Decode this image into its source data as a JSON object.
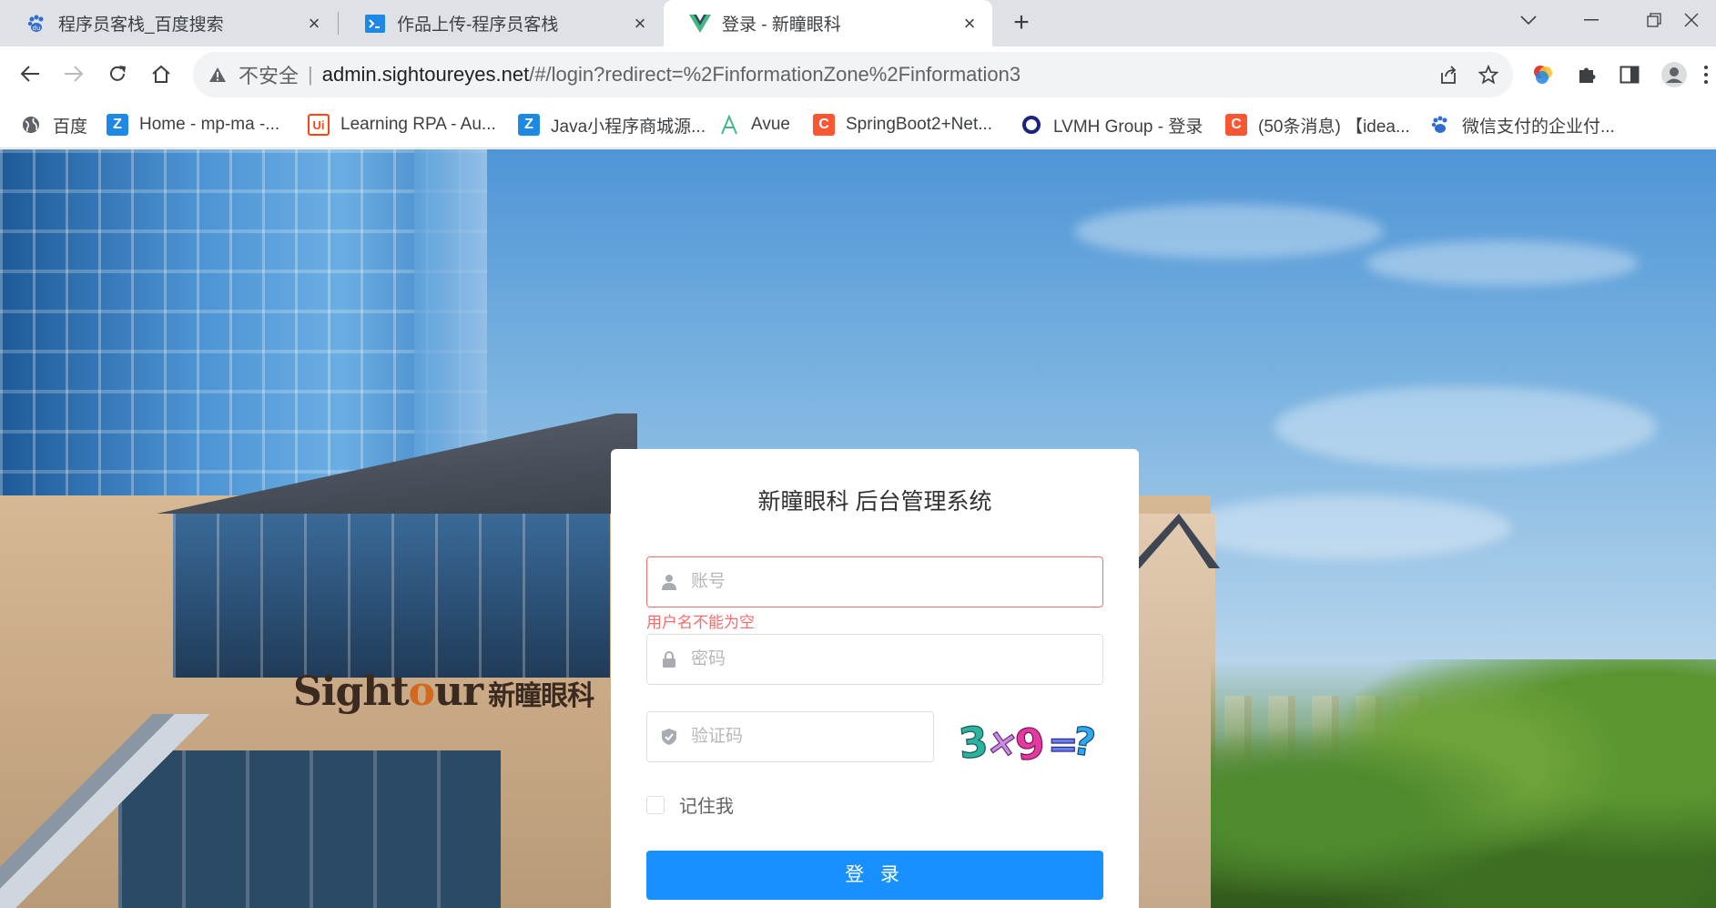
{
  "browser": {
    "tabs": [
      {
        "title": "程序员客栈_百度搜索",
        "active": false,
        "favicon": "baidu-paw-icon"
      },
      {
        "title": "作品上传-程序员客栈",
        "active": false,
        "favicon": "terminal-icon"
      },
      {
        "title": "登录 - 新瞳眼科",
        "active": true,
        "favicon": "vue-logo-icon"
      }
    ],
    "address": {
      "security_label": "不安全",
      "host": "admin.sightoureyes.net",
      "path": "/#/login?redirect=%2FinformationZone%2Finformation3"
    },
    "bookmarks": [
      {
        "label": "百度",
        "icon": "globe-icon",
        "color": "#5f6368"
      },
      {
        "label": "Home - mp-ma -...",
        "icon": "z-logo-icon",
        "color": "#1e88e5"
      },
      {
        "label": "Learning RPA - Au...",
        "icon": "uipath-icon",
        "color": "#fa4616"
      },
      {
        "label": "Java小程序商城源...",
        "icon": "z-logo-icon",
        "color": "#1e88e5"
      },
      {
        "label": "Avue",
        "icon": "avue-icon",
        "color": "#42b983"
      },
      {
        "label": "SpringBoot2+Net...",
        "icon": "csdn-icon",
        "color": "#fc5531"
      },
      {
        "label": "LVMH Group - 登录",
        "icon": "lvmh-ring-icon",
        "color": "#1a237e"
      },
      {
        "label": "(50条消息) 【idea...",
        "icon": "csdn-icon",
        "color": "#fc5531"
      },
      {
        "label": "微信支付的企业付...",
        "icon": "baidu-paw-icon",
        "color": "#2f6bd1"
      }
    ]
  },
  "background": {
    "sign_prefix": "Sight",
    "sign_o": "o",
    "sign_suffix": "ur",
    "sign_cn": "新瞳眼科"
  },
  "login": {
    "title": "新瞳眼科 后台管理系统",
    "username_placeholder": "账号",
    "username_error": "用户名不能为空",
    "password_placeholder": "密码",
    "captcha_placeholder": "验证码",
    "captcha_text": [
      "3",
      "×",
      "9",
      "=",
      "?"
    ],
    "remember_label": "记住我",
    "submit_label": "登 录",
    "accent": "#1890ff",
    "error_color": "#f56c6c"
  }
}
